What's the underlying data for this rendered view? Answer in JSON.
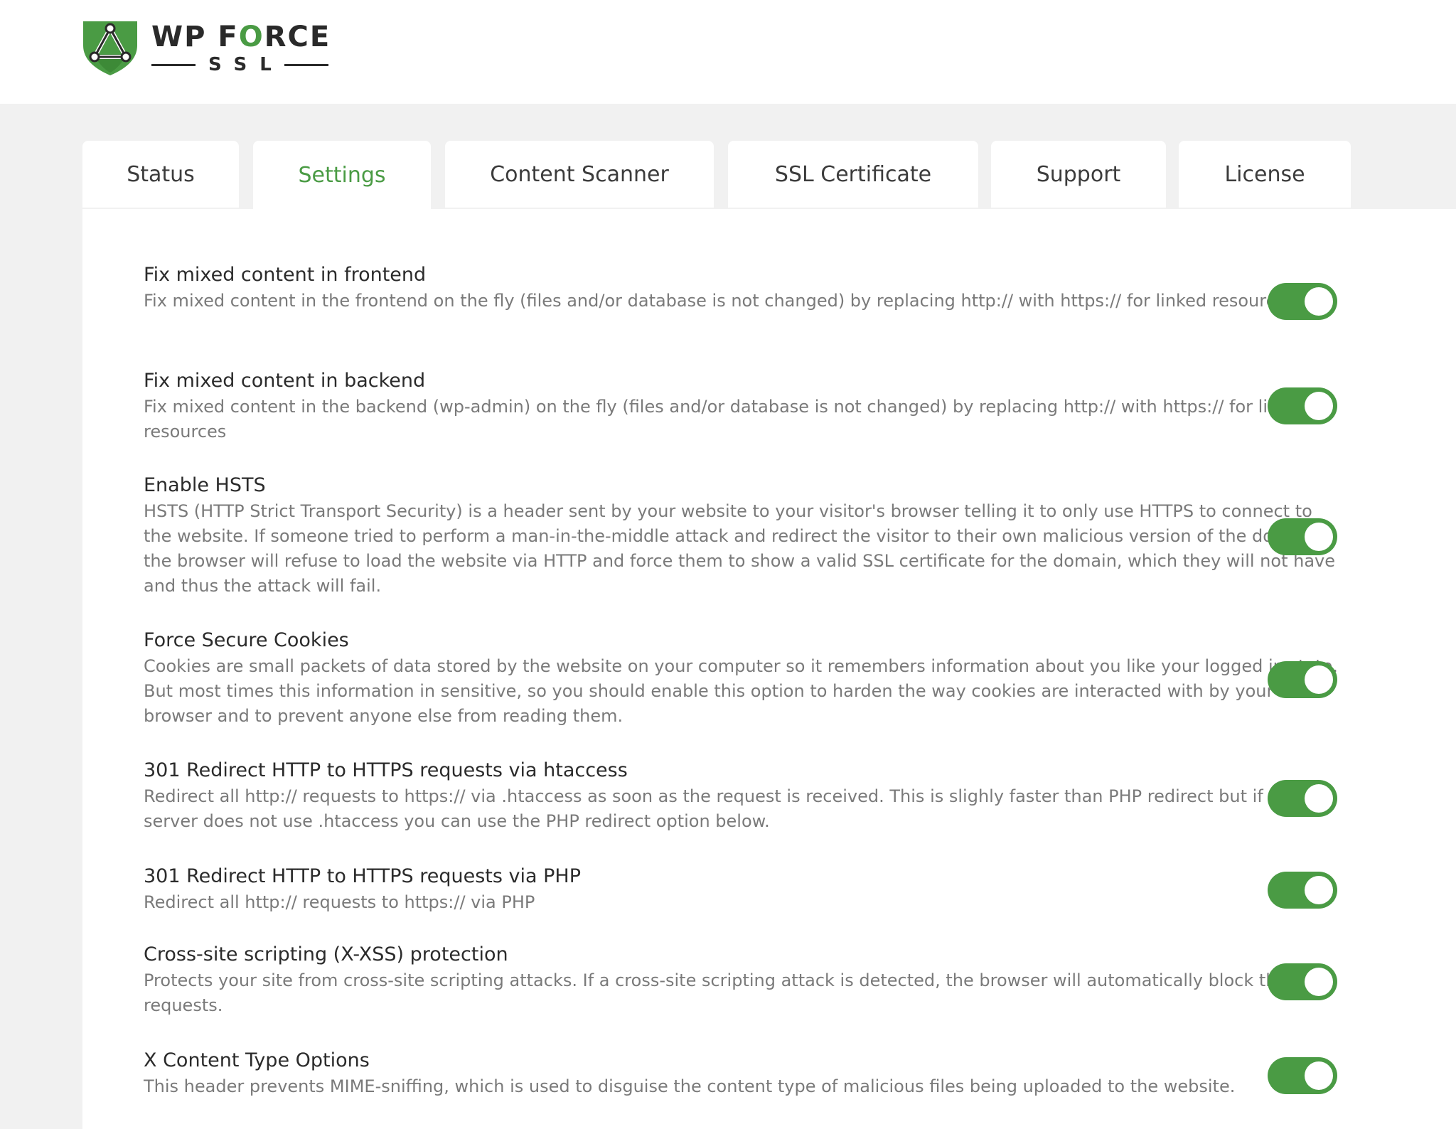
{
  "brand": {
    "name_part1": "WP F",
    "name_accent": "O",
    "name_part2": "RCE",
    "sub": "SSL",
    "accent_color": "#4a9b44"
  },
  "tabs": [
    {
      "label": "Status"
    },
    {
      "label": "Settings",
      "active": true
    },
    {
      "label": "Content Scanner"
    },
    {
      "label": "SSL Certificate"
    },
    {
      "label": "Support"
    },
    {
      "label": "License"
    }
  ],
  "settings": [
    {
      "title": "Fix mixed content in frontend",
      "description": "Fix mixed content in the frontend on the fly (files and/or database is not changed) by replacing http:// with https:// for linked resources.",
      "enabled": true
    },
    {
      "title": "Fix mixed content in backend",
      "description": "Fix mixed content in the backend (wp-admin) on the fly (files and/or database is not changed) by replacing http:// with https:// for linked resources",
      "enabled": true
    },
    {
      "title": "Enable HSTS",
      "description": "HSTS (HTTP Strict Transport Security) is a header sent by your website to your visitor's browser telling it to only use HTTPS to connect to the website. If someone tried to perform a man-in-the-middle attack and redirect the visitor to their own malicious version of the domain the browser will refuse to load the website via HTTP and force them to show a valid SSL certificate for the domain, which they will not have and thus the attack will fail.",
      "enabled": true
    },
    {
      "title": "Force Secure Cookies",
      "description": "Cookies are small packets of data stored by the website on your computer so it remembers information about you like your logged in state. But most times this information in sensitive, so you should enable this option to harden the way cookies are interacted with by your browser and to prevent anyone else from reading them.",
      "enabled": true
    },
    {
      "title": "301 Redirect HTTP to HTTPS requests via htaccess",
      "description": "Redirect all http:// requests to https:// via .htaccess as soon as the request is received. This is slighly faster than PHP redirect but if your server does not use .htaccess you can use the PHP redirect option below.",
      "enabled": true
    },
    {
      "title": "301 Redirect HTTP to HTTPS requests via PHP",
      "description": "Redirect all http:// requests to https:// via PHP",
      "enabled": true
    },
    {
      "title": "Cross-site scripting (X-XSS) protection",
      "description": "Protects your site from cross-site scripting attacks. If a cross-site scripting attack is detected, the browser will automatically block these requests.",
      "enabled": true
    },
    {
      "title": "X Content Type Options",
      "description": "This header prevents MIME-sniffing, which is used to disguise the content type of malicious files being uploaded to the website.",
      "enabled": true
    }
  ]
}
